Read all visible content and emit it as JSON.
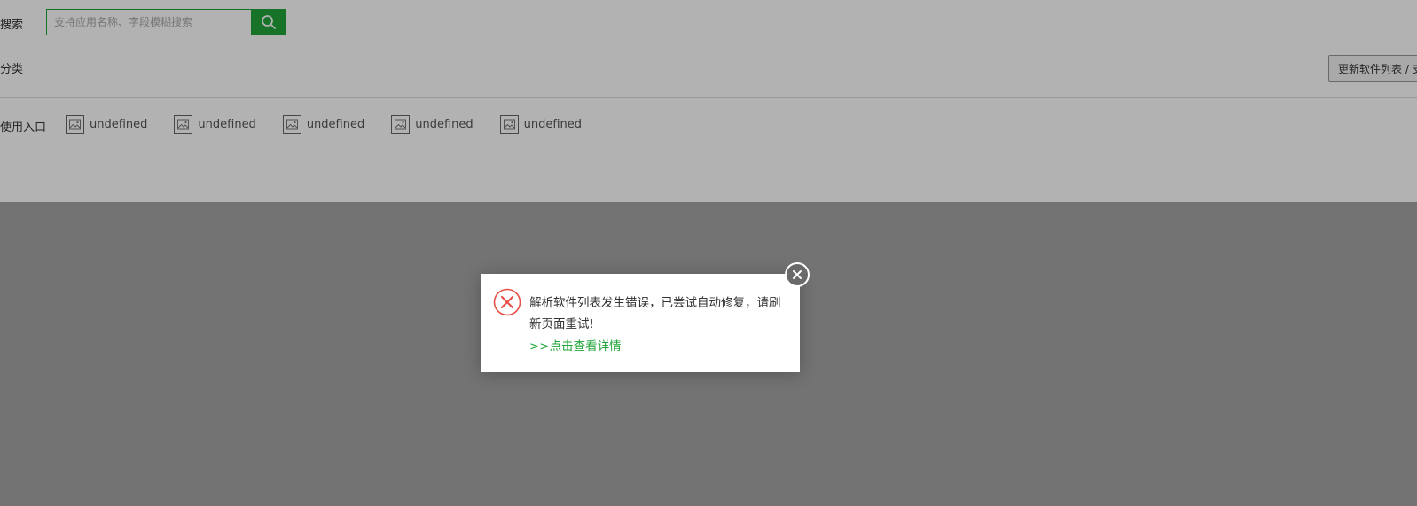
{
  "search": {
    "label": "搜索",
    "placeholder": "支持应用名称、字段模糊搜索"
  },
  "category": {
    "label": "分类"
  },
  "toolbar": {
    "update_label": "更新软件列表 / 支"
  },
  "entries": {
    "label": "使用入口",
    "items": [
      {
        "label": "undefined"
      },
      {
        "label": "undefined"
      },
      {
        "label": "undefined"
      },
      {
        "label": "undefined"
      },
      {
        "label": "undefined"
      }
    ]
  },
  "dialog": {
    "message": "解析软件列表发生错误，已尝试自动修复，请刷新页面重试!",
    "link": ">>点击查看详情"
  },
  "colors": {
    "accent": "#20a53a",
    "error": "#e8514a",
    "close_bg": "#6a6a6a"
  }
}
